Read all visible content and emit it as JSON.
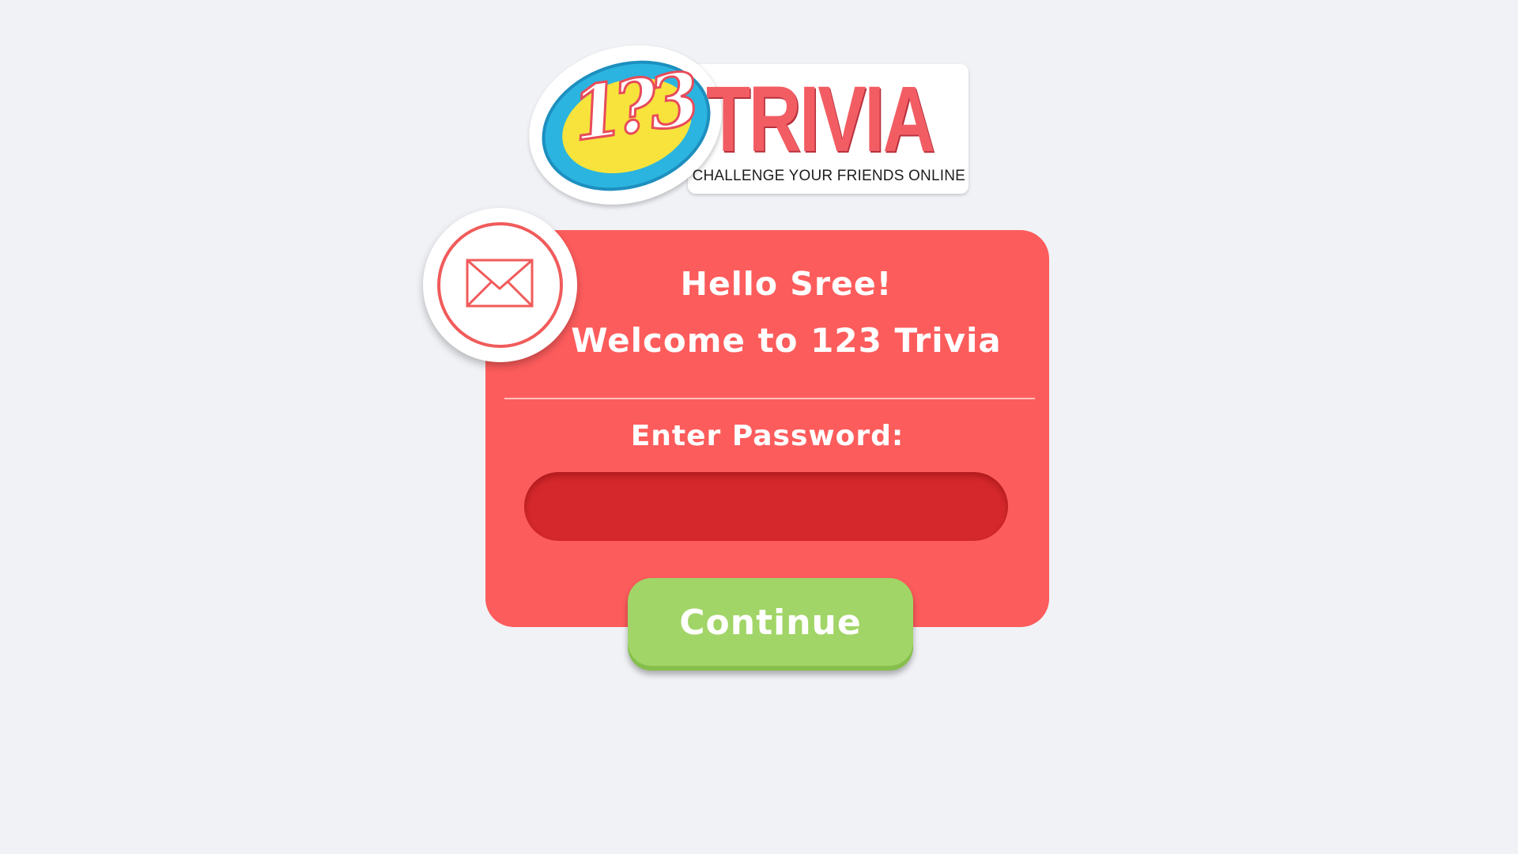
{
  "logo": {
    "numbers": "1?3",
    "word": "TRIVIA",
    "tagline": "CHALLENGE YOUR FRIENDS ONLINE"
  },
  "card": {
    "greeting": "Hello Sree!",
    "welcome": "Welcome to 123 Trivia",
    "password_label": "Enter Password:",
    "password_value": "",
    "badge_icon": "mail-icon"
  },
  "actions": {
    "continue_label": "Continue"
  },
  "colors": {
    "background": "#f0f2f6",
    "card": "#fd5c5c",
    "input": "#d4282c",
    "button": "#a1d567",
    "logo_red": "#f25d63",
    "logo_blue": "#2bb4df",
    "logo_yellow": "#f7e33c"
  }
}
